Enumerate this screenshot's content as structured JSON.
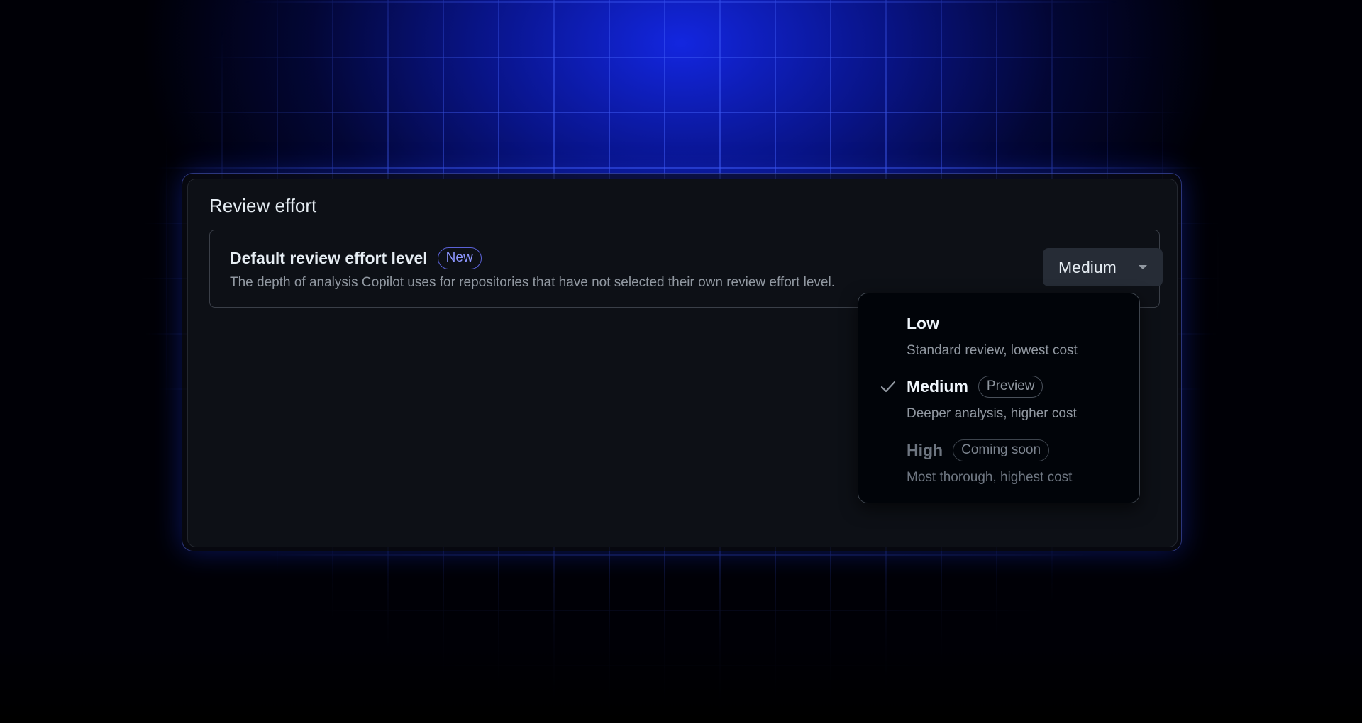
{
  "section": {
    "title": "Review effort"
  },
  "setting": {
    "title": "Default review effort level",
    "badge": "New",
    "description": "The depth of analysis Copilot uses for repositories that have not selected their own review effort level.",
    "selected_value": "Medium"
  },
  "dropdown": {
    "options": [
      {
        "label": "Low",
        "description": "Standard review, lowest cost",
        "badge": "",
        "selected": false,
        "disabled": false
      },
      {
        "label": "Medium",
        "description": "Deeper analysis, higher cost",
        "badge": "Preview",
        "selected": true,
        "disabled": false
      },
      {
        "label": "High",
        "description": "Most thorough, highest cost",
        "badge": "Coming soon",
        "selected": false,
        "disabled": true
      }
    ]
  },
  "icons": {
    "check": "check-icon",
    "caret": "triangle-down-icon"
  },
  "colors": {
    "accent_badge": "#8d96ff",
    "panel_background": "#0d1016",
    "dropdown_background": "#010409",
    "backdrop_glow": "#1428eb"
  }
}
